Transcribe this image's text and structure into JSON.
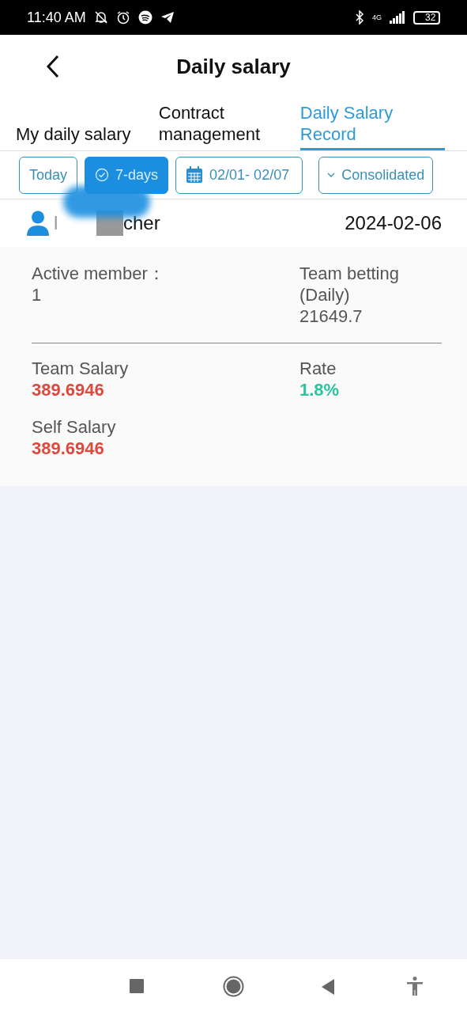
{
  "status_bar": {
    "time": "11:40 AM",
    "network": "4G",
    "battery": "32"
  },
  "header": {
    "title": "Daily salary"
  },
  "tabs": [
    {
      "label": "My daily salary",
      "selected": false
    },
    {
      "label": "Contract management",
      "selected": false
    },
    {
      "label": "Daily Salary Record",
      "selected": true
    }
  ],
  "filters": [
    {
      "kind": "chip",
      "label": "Today",
      "selected": false
    },
    {
      "kind": "chip",
      "label": "7-days",
      "selected": true
    },
    {
      "kind": "date",
      "label": "02/01- 02/07"
    },
    {
      "kind": "dropdown",
      "label": "Consolidated"
    }
  ],
  "record": {
    "name_start": "l",
    "name_end": "cher",
    "date": "2024-02-06",
    "stats": [
      {
        "label": "Active member：",
        "value": "1",
        "color": "#555555"
      },
      {
        "label": "Team betting (Daily)",
        "value": "21649.7",
        "color": "#555555"
      },
      {
        "label": "Team Salary",
        "value": "389.6946",
        "color": "#dc4a3e"
      },
      {
        "label": "Rate",
        "value": "1.8%",
        "color": "#2bc3a0"
      },
      {
        "label": "Self Salary",
        "value": "389.6946",
        "color": "#dc4a3e"
      }
    ]
  }
}
